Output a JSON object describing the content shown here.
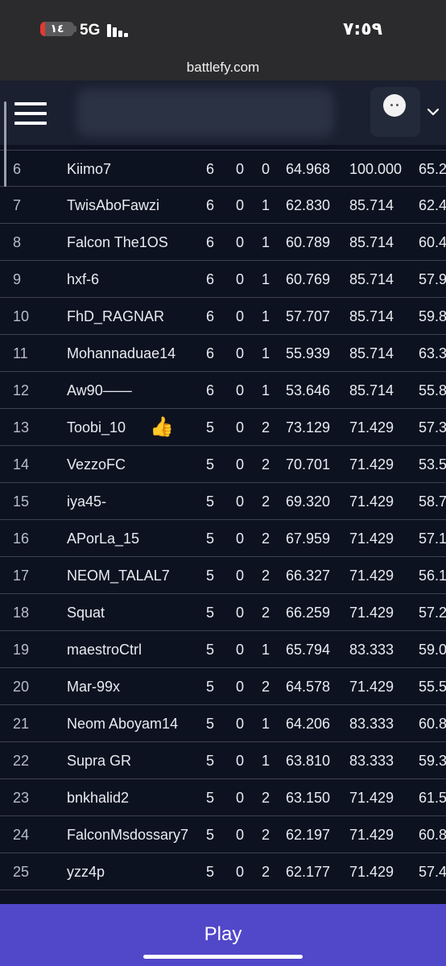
{
  "status_bar": {
    "battery_level": "١٤",
    "battery_fraction": 0.14,
    "network": "5G",
    "time": "٧:٥٩"
  },
  "browser": {
    "url": "battlefy.com"
  },
  "header": {
    "menu_icon": "hamburger-menu-icon",
    "avatar_icon": "user-avatar-icon",
    "dropdown_icon": "chevron-down-icon"
  },
  "standings": {
    "rows": [
      {
        "rank": "6",
        "name": "Kiimo7",
        "w": "6",
        "d": "0",
        "l": "0",
        "s1": "64.968",
        "s2": "100.000",
        "s3": "65.2"
      },
      {
        "rank": "7",
        "name": "TwisAboFawzi",
        "w": "6",
        "d": "0",
        "l": "1",
        "s1": "62.830",
        "s2": "85.714",
        "s3": "62.4"
      },
      {
        "rank": "8",
        "name": "Falcon The1OS",
        "w": "6",
        "d": "0",
        "l": "1",
        "s1": "60.789",
        "s2": "85.714",
        "s3": "60.4"
      },
      {
        "rank": "9",
        "name": "hxf-6",
        "w": "6",
        "d": "0",
        "l": "1",
        "s1": "60.769",
        "s2": "85.714",
        "s3": "57.9"
      },
      {
        "rank": "10",
        "name": "FhD_RAGNAR",
        "w": "6",
        "d": "0",
        "l": "1",
        "s1": "57.707",
        "s2": "85.714",
        "s3": "59.8"
      },
      {
        "rank": "11",
        "name": "Mohannaduae14",
        "w": "6",
        "d": "0",
        "l": "1",
        "s1": "55.939",
        "s2": "85.714",
        "s3": "63.3"
      },
      {
        "rank": "12",
        "name": "Aw90——",
        "w": "6",
        "d": "0",
        "l": "1",
        "s1": "53.646",
        "s2": "85.714",
        "s3": "55.8"
      },
      {
        "rank": "13",
        "name": "Toobi_10",
        "w": "5",
        "d": "0",
        "l": "2",
        "s1": "73.129",
        "s2": "71.429",
        "s3": "57.3",
        "emoji": "👍"
      },
      {
        "rank": "14",
        "name": "VezzoFC",
        "w": "5",
        "d": "0",
        "l": "2",
        "s1": "70.701",
        "s2": "71.429",
        "s3": "53.5"
      },
      {
        "rank": "15",
        "name": "iya45-",
        "w": "5",
        "d": "0",
        "l": "2",
        "s1": "69.320",
        "s2": "71.429",
        "s3": "58.7"
      },
      {
        "rank": "16",
        "name": "APorLa_15",
        "w": "5",
        "d": "0",
        "l": "2",
        "s1": "67.959",
        "s2": "71.429",
        "s3": "57.1"
      },
      {
        "rank": "17",
        "name": "NEOM_TALAL7",
        "w": "5",
        "d": "0",
        "l": "2",
        "s1": "66.327",
        "s2": "71.429",
        "s3": "56.1"
      },
      {
        "rank": "18",
        "name": "Squat",
        "w": "5",
        "d": "0",
        "l": "2",
        "s1": "66.259",
        "s2": "71.429",
        "s3": "57.2"
      },
      {
        "rank": "19",
        "name": "maestroCtrl",
        "w": "5",
        "d": "0",
        "l": "1",
        "s1": "65.794",
        "s2": "83.333",
        "s3": "59.0"
      },
      {
        "rank": "20",
        "name": "Mar-99x",
        "w": "5",
        "d": "0",
        "l": "2",
        "s1": "64.578",
        "s2": "71.429",
        "s3": "55.5"
      },
      {
        "rank": "21",
        "name": "Neom Aboyam14",
        "w": "5",
        "d": "0",
        "l": "1",
        "s1": "64.206",
        "s2": "83.333",
        "s3": "60.8"
      },
      {
        "rank": "22",
        "name": "Supra GR",
        "w": "5",
        "d": "0",
        "l": "1",
        "s1": "63.810",
        "s2": "83.333",
        "s3": "59.3"
      },
      {
        "rank": "23",
        "name": "bnkhalid2",
        "w": "5",
        "d": "0",
        "l": "2",
        "s1": "63.150",
        "s2": "71.429",
        "s3": "61.5"
      },
      {
        "rank": "24",
        "name": "FalconMsdossary7",
        "w": "5",
        "d": "0",
        "l": "2",
        "s1": "62.197",
        "s2": "71.429",
        "s3": "60.8"
      },
      {
        "rank": "25",
        "name": "yzz4p",
        "w": "5",
        "d": "0",
        "l": "2",
        "s1": "62.177",
        "s2": "71.429",
        "s3": "57.4"
      }
    ]
  },
  "footer": {
    "play_label": "Play"
  },
  "colors": {
    "page_bg": "#0d1220",
    "header_bg": "#1a2030",
    "row_divider": "#3b4253",
    "play_button": "#5147c9",
    "battery_fill": "#e5392f"
  }
}
